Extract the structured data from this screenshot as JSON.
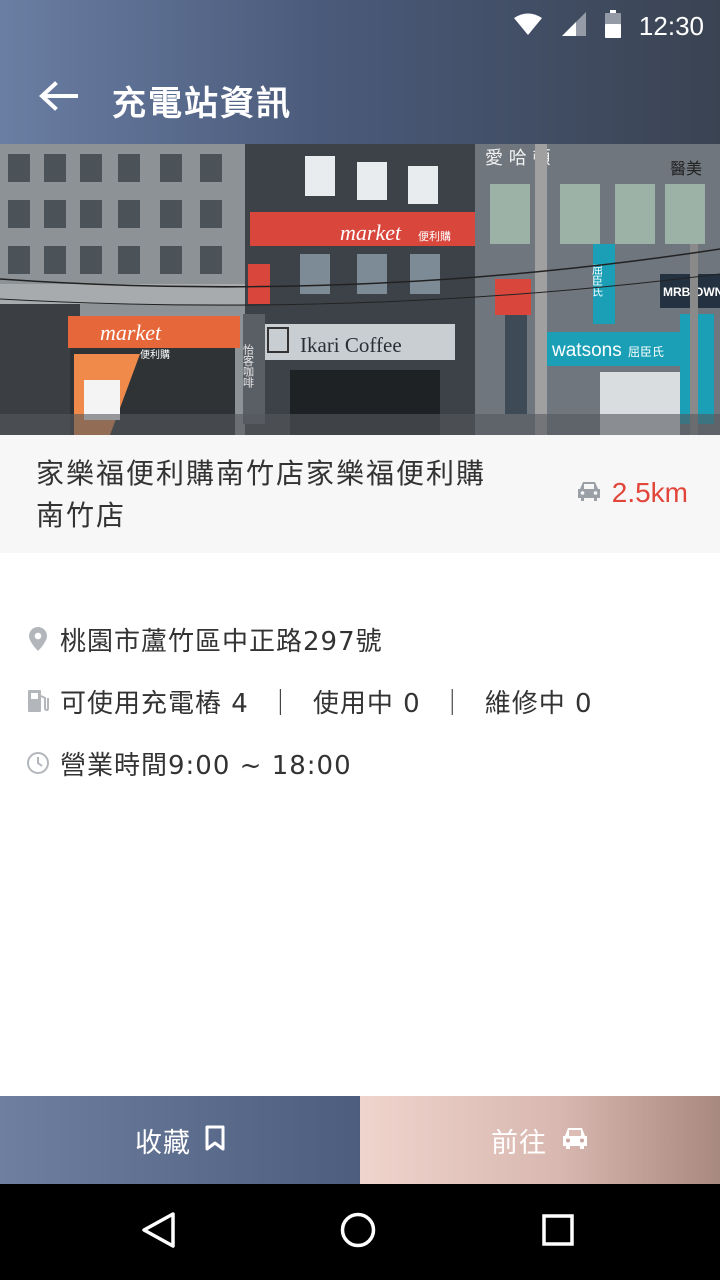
{
  "status_bar": {
    "time": "12:30",
    "icons": [
      "wifi-icon",
      "signal-icon",
      "battery-icon"
    ]
  },
  "toolbar": {
    "back_icon": "arrow-left-icon",
    "title": "充電站資訊"
  },
  "photo": {
    "signs": {
      "market_top": "market",
      "market_top_sub": "便利購",
      "market_left": "market",
      "market_left_sub": "便利購",
      "cafe": "Ikari Coffee",
      "cafe_vertical": "怡客咖啡",
      "watsons": "watsons",
      "watsons_sub": "屈臣氏",
      "top_right": "愛 哈 頓",
      "top_right_small": "醫美",
      "mrb": "MRB",
      "town": "OWN",
      "vertical_right": "屈臣氏"
    }
  },
  "station": {
    "name": "家樂福便利購南竹店家樂福便利購南竹店",
    "distance": "2.5km",
    "distance_icon": "car-icon"
  },
  "info": {
    "address": "桃園市蘆竹區中正路297號",
    "chargers": "可使用充電樁 4  ｜  使用中 0  ｜  維修中 0",
    "hours": "營業時間9:00 ~ 18:00"
  },
  "actions": {
    "favorite_label": "收藏",
    "favorite_icon": "bookmark-icon",
    "go_label": "前往",
    "go_icon": "car-icon"
  },
  "nav": {
    "icons": [
      "back-triangle-icon",
      "home-circle-icon",
      "recents-square-icon"
    ]
  },
  "colors": {
    "accent_red": "#e2463a",
    "appbar": "#4a5a7a"
  }
}
